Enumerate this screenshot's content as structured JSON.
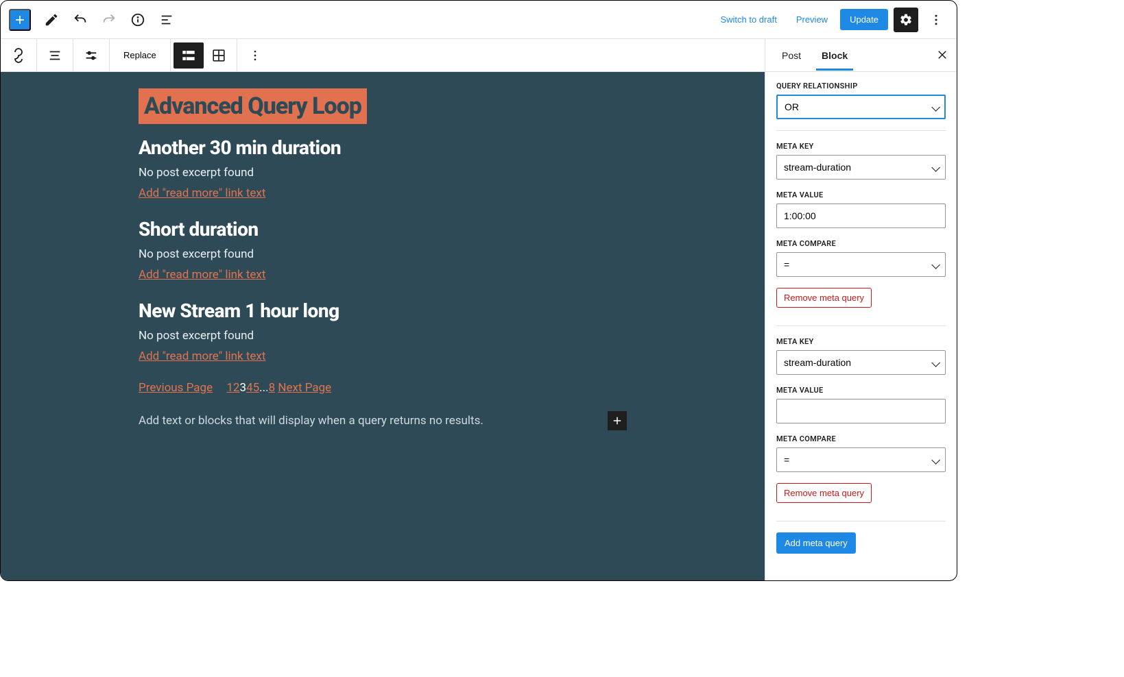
{
  "topbar": {
    "switch_draft": "Switch to draft",
    "preview": "Preview",
    "update": "Update"
  },
  "block_toolbar": {
    "replace": "Replace"
  },
  "page": {
    "title": "Advanced Query Loop",
    "posts": [
      {
        "title": "Another 30 min duration",
        "excerpt": "No post excerpt found",
        "readmore": "Add \"read more\" link text"
      },
      {
        "title": "Short duration",
        "excerpt": "No post excerpt found",
        "readmore": "Add \"read more\" link text"
      },
      {
        "title": "New Stream 1 hour long",
        "excerpt": "No post excerpt found",
        "readmore": "Add \"read more\" link text"
      }
    ],
    "pagination": {
      "prev": "Previous Page",
      "next": "Next Page",
      "pages": [
        "1",
        "2",
        "3",
        "4",
        "5",
        "...",
        "8"
      ],
      "current": "3"
    },
    "no_results": "Add text or blocks that will display when a query returns no results."
  },
  "sidebar": {
    "tabs": {
      "post": "Post",
      "block": "Block"
    },
    "labels": {
      "query_relationship": "Query Relationship",
      "meta_key": "Meta Key",
      "meta_value": "Meta Value",
      "meta_compare": "Meta Compare",
      "remove": "Remove meta query",
      "add": "Add meta query"
    },
    "query_relationship": "OR",
    "queries": [
      {
        "meta_key": "stream-duration",
        "meta_value": "1:00:00",
        "meta_compare": "="
      },
      {
        "meta_key": "stream-duration",
        "meta_value": "",
        "meta_compare": "="
      }
    ]
  }
}
